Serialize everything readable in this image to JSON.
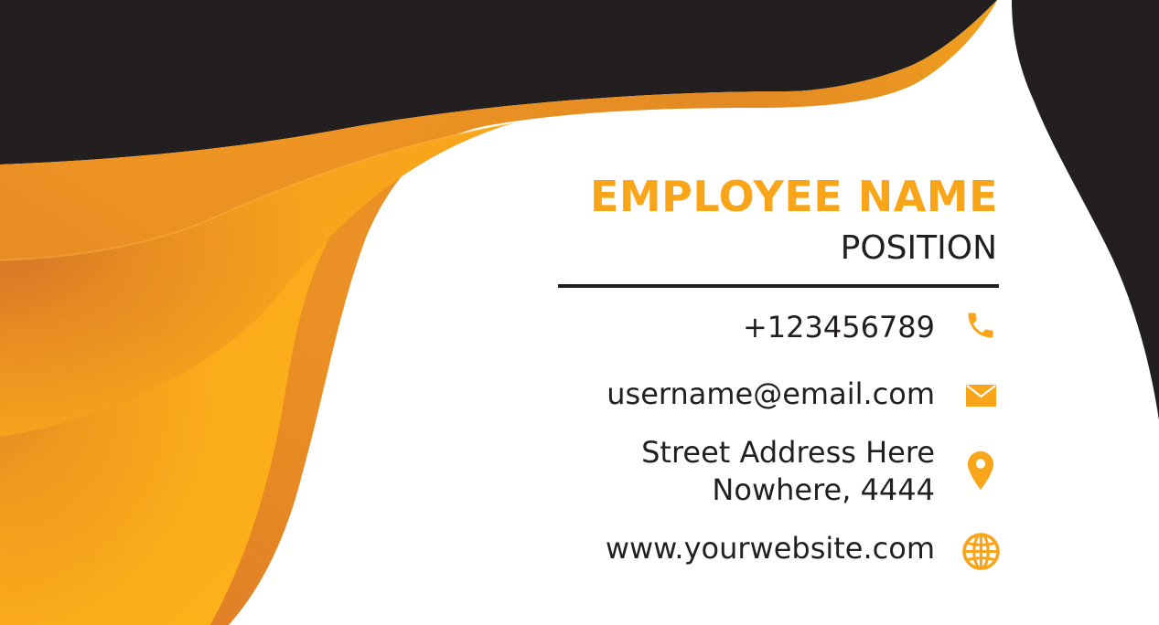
{
  "colors": {
    "accent": "#f9a51a",
    "accent_dark": "#dd7a27",
    "dark": "#231f20",
    "background": "#ffffff"
  },
  "card": {
    "name": "EMPLOYEE NAME",
    "position": "POSITION"
  },
  "contacts": {
    "phone": {
      "value": "+123456789",
      "icon": "phone-icon"
    },
    "email": {
      "value": "username@email.com",
      "icon": "envelope-icon"
    },
    "address": {
      "line1": "Street Address Here",
      "line2": "Nowhere, 4444",
      "icon": "location-pin-icon"
    },
    "website": {
      "value": "www.yourwebsite.com",
      "icon": "globe-icon"
    }
  }
}
